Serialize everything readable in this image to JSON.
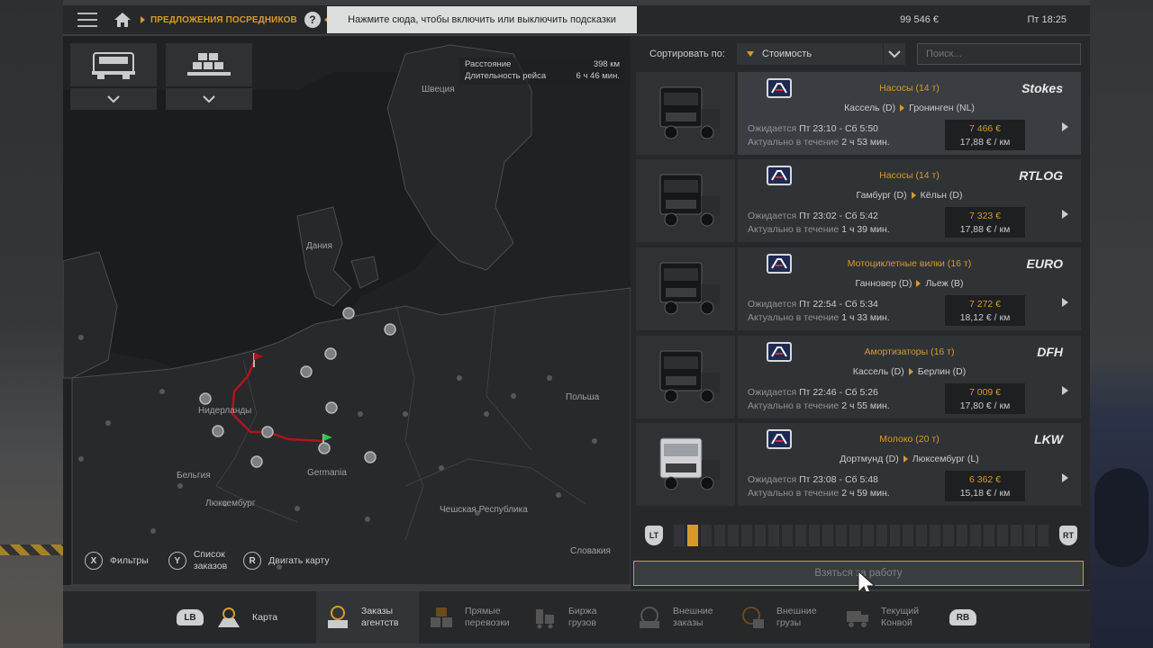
{
  "topbar": {
    "breadcrumb": "ПРЕДЛОЖЕНИЯ ПОСРЕДНИКОВ",
    "help": "?",
    "tooltip": "Нажмите сюда, чтобы включить или выключить подсказки",
    "money": "99 546 €",
    "time": "Пт 18:25"
  },
  "map": {
    "route_info": {
      "distance_label": "Расстояние",
      "distance_value": "398 км",
      "duration_label": "Длительность рейса",
      "duration_value": "6 ч 46 мин."
    },
    "countries": {
      "sweden": "Швеция",
      "denmark": "Дания",
      "netherlands": "Нидерланды",
      "poland": "Польша",
      "belgium": "Бельгия",
      "germany": "Germania",
      "luxembourg": "Люксембург",
      "czech": "Чешская Республика",
      "slovakia": "Словакия"
    },
    "hints": {
      "filters_key": "X",
      "filters": "Фильтры",
      "list_key": "Y",
      "list_line1": "Список",
      "list_line2": "заказов",
      "move_key": "R",
      "move": "Двигать карту"
    },
    "route_color": "#b0141c"
  },
  "list": {
    "sort_label": "Сортировать по:",
    "sort_value": "Стоимость",
    "search_placeholder": "Поиск...",
    "jobs": [
      {
        "cargo": "Насосы (14 т)",
        "from": "Кассель (D)",
        "to": "Гронинген (NL)",
        "brand": "Stokes",
        "expected_label": "Ожидается",
        "expected": "Пт 23:10 - Сб 5:50",
        "valid_label": "Актуально в течение",
        "valid": "2 ч 53 мин.",
        "price": "7 466 €",
        "rate": "17,88 € / км"
      },
      {
        "cargo": "Насосы (14 т)",
        "from": "Гамбург (D)",
        "to": "Кёльн (D)",
        "brand": "RTLOG",
        "expected_label": "Ожидается",
        "expected": "Пт 23:02 - Сб 5:42",
        "valid_label": "Актуально в течение",
        "valid": "1 ч 39 мин.",
        "price": "7 323 €",
        "rate": "17,88 € / км"
      },
      {
        "cargo": "Мотоциклетные вилки (16 т)",
        "from": "Ганновер (D)",
        "to": "Льеж (B)",
        "brand": "EURO",
        "expected_label": "Ожидается",
        "expected": "Пт 22:54 - Сб 5:34",
        "valid_label": "Актуально в течение",
        "valid": "1 ч 33 мин.",
        "price": "7 272 €",
        "rate": "18,12 € / км"
      },
      {
        "cargo": "Амортизаторы (16 т)",
        "from": "Кассель (D)",
        "to": "Берлин (D)",
        "brand": "DFH",
        "expected_label": "Ожидается",
        "expected": "Пт 22:46 - Сб 5:26",
        "valid_label": "Актуально в течение",
        "valid": "2 ч 55 мин.",
        "price": "7 009 €",
        "rate": "17,80 € / км"
      },
      {
        "cargo": "Молоко (20 т)",
        "from": "Дортмунд (D)",
        "to": "Люксембург (L)",
        "brand": "LKW",
        "expected_label": "Ожидается",
        "expected": "Пт 23:08 - Сб 5:48",
        "valid_label": "Актуально в течение",
        "valid": "2 ч 59 мин.",
        "price": "6 362 €",
        "rate": "15,18 € / км"
      }
    ],
    "pager": {
      "lt": "LT",
      "rt": "RT",
      "active_page": 1
    },
    "take_job": "Взяться за работу"
  },
  "bottom": {
    "lb": "LB",
    "rb": "RB",
    "items": [
      {
        "label1": "Карта",
        "label2": ""
      },
      {
        "label1": "Заказы",
        "label2": "агентств"
      },
      {
        "label1": "Прямые",
        "label2": "перевозки"
      },
      {
        "label1": "Биржа",
        "label2": "грузов"
      },
      {
        "label1": "Внешние",
        "label2": "заказы"
      },
      {
        "label1": "Внешние",
        "label2": "грузы"
      },
      {
        "label1": "Текущий",
        "label2": "Конвой"
      }
    ]
  },
  "colors": {
    "accent": "#d79a2a",
    "panel": "#26282a",
    "map_bg": "#232527"
  }
}
